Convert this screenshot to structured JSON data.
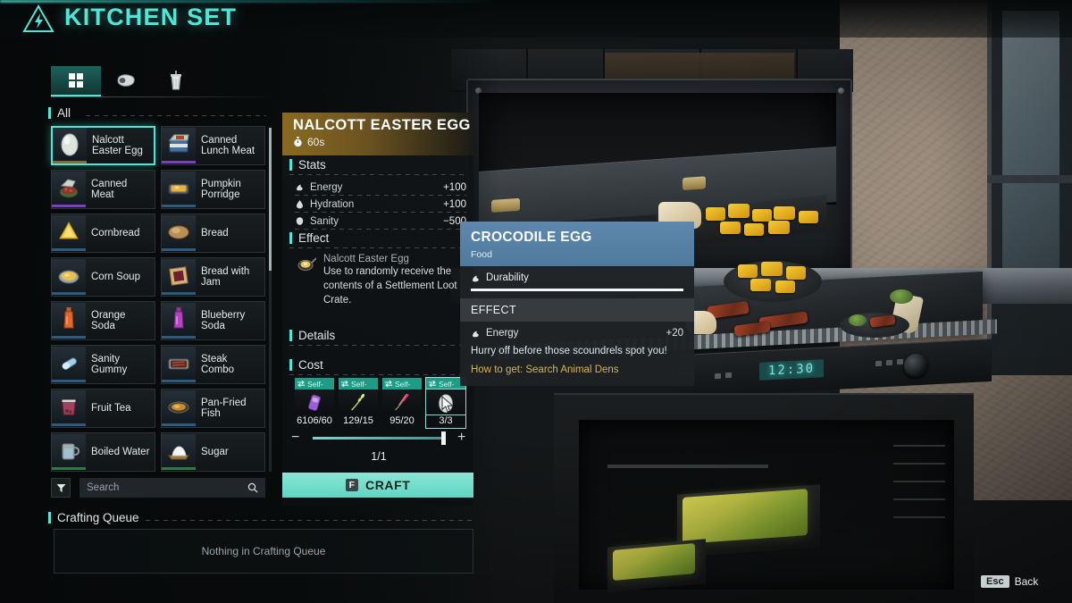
{
  "header": {
    "title": "KITCHEN SET",
    "icon": "electric-hazard-triangle-icon",
    "accent_color": "#4fe6d7"
  },
  "tabs": [
    {
      "id": "all",
      "icon": "grid-icon",
      "active": true
    },
    {
      "id": "food",
      "icon": "steak-icon",
      "active": false
    },
    {
      "id": "drinks",
      "icon": "cup-icon",
      "active": false
    }
  ],
  "category": {
    "label": "All"
  },
  "items": [
    {
      "name": "Nalcott Easter Egg",
      "icon": "egg-icon",
      "rarity": "brown",
      "selected": true
    },
    {
      "name": "Canned Lunch Meat",
      "icon": "canned-meat-icon",
      "rarity": "purple",
      "selected": false
    },
    {
      "name": "Canned Meat",
      "icon": "open-can-icon",
      "rarity": "purple",
      "selected": false
    },
    {
      "name": "Pumpkin Porridge",
      "icon": "porridge-bowl-icon",
      "rarity": "blue",
      "selected": false
    },
    {
      "name": "Cornbread",
      "icon": "cornbread-icon",
      "rarity": "blue",
      "selected": false
    },
    {
      "name": "Bread",
      "icon": "bread-loaf-icon",
      "rarity": "blue",
      "selected": false
    },
    {
      "name": "Corn Soup",
      "icon": "soup-bowl-icon",
      "rarity": "blue",
      "selected": false
    },
    {
      "name": "Bread with Jam",
      "icon": "jam-toast-icon",
      "rarity": "blue",
      "selected": false
    },
    {
      "name": "Orange Soda",
      "icon": "orange-bottle-icon",
      "rarity": "blue",
      "selected": false
    },
    {
      "name": "Blueberry Soda",
      "icon": "purple-bottle-icon",
      "rarity": "blue",
      "selected": false
    },
    {
      "name": "Sanity Gummy",
      "icon": "capsule-icon",
      "rarity": "blue",
      "selected": false
    },
    {
      "name": "Steak Combo",
      "icon": "steak-tray-icon",
      "rarity": "blue",
      "selected": false
    },
    {
      "name": "Fruit Tea",
      "icon": "tea-cup-icon",
      "rarity": "blue",
      "selected": false
    },
    {
      "name": "Pan-Fried Fish",
      "icon": "fried-fish-icon",
      "rarity": "blue",
      "selected": false
    },
    {
      "name": "Boiled Water",
      "icon": "water-mug-icon",
      "rarity": "green",
      "selected": false
    },
    {
      "name": "Sugar",
      "icon": "sugar-pile-icon",
      "rarity": "green",
      "selected": false
    }
  ],
  "search": {
    "placeholder": "Search",
    "value": "",
    "icon": "search-icon",
    "filter_icon": "filter-icon"
  },
  "crafting_queue": {
    "label": "Crafting Queue",
    "empty_text": "Nothing in Crafting Queue"
  },
  "detail": {
    "title": "NALCOTT EASTER EGG",
    "craft_time": "60s",
    "craft_time_icon": "stopwatch-icon",
    "stats_label": "Stats",
    "stats": [
      {
        "name": "Energy",
        "icon": "energy-icon",
        "value": "+100"
      },
      {
        "name": "Hydration",
        "icon": "hydration-icon",
        "value": "+100"
      },
      {
        "name": "Sanity",
        "icon": "sanity-icon",
        "value": "−500"
      }
    ],
    "effect_label": "Effect",
    "effect": {
      "name": "Nalcott Easter Egg",
      "icon": "pan-effect-icon",
      "description": "Use to randomly receive the contents of a Settlement Loot Crate."
    },
    "details_label": "Details",
    "cost_label": "Cost",
    "cost_slots": [
      {
        "tag": "Self-",
        "tag_icon": "swap-icon",
        "icon": "purple-canister-icon",
        "qty": "6106/60",
        "hovered": false
      },
      {
        "tag": "Self-",
        "tag_icon": "swap-icon",
        "icon": "wheat-stalk-icon",
        "qty": "129/15",
        "hovered": false
      },
      {
        "tag": "Self-",
        "tag_icon": "swap-icon",
        "icon": "red-herb-icon",
        "qty": "95/20",
        "hovered": false
      },
      {
        "tag": "Self-",
        "tag_icon": "swap-icon",
        "icon": "egg-icon",
        "qty": "3/3",
        "hovered": true
      }
    ],
    "quantity": {
      "value": "1/1",
      "minus": "−",
      "plus": "+",
      "fill_percent": 100
    },
    "craft_button": {
      "key": "F",
      "label": "CRAFT"
    }
  },
  "tooltip": {
    "title": "CROCODILE EGG",
    "subtitle": "Food",
    "durability_label": "Durability",
    "durability_icon": "energy-icon",
    "durability_percent": 100,
    "effect_header": "EFFECT",
    "effects": [
      {
        "name": "Energy",
        "icon": "energy-icon",
        "value": "+20"
      }
    ],
    "flavor_text": "Hurry off before those scoundrels spot you!",
    "how_to_get": "How to get: Search Animal Dens",
    "header_color": "#4e7a9e",
    "how_to_get_color": "#d7b34e"
  },
  "footer": {
    "key": "Esc",
    "label": "Back"
  },
  "scene": {
    "oven_clock": "12:30"
  }
}
